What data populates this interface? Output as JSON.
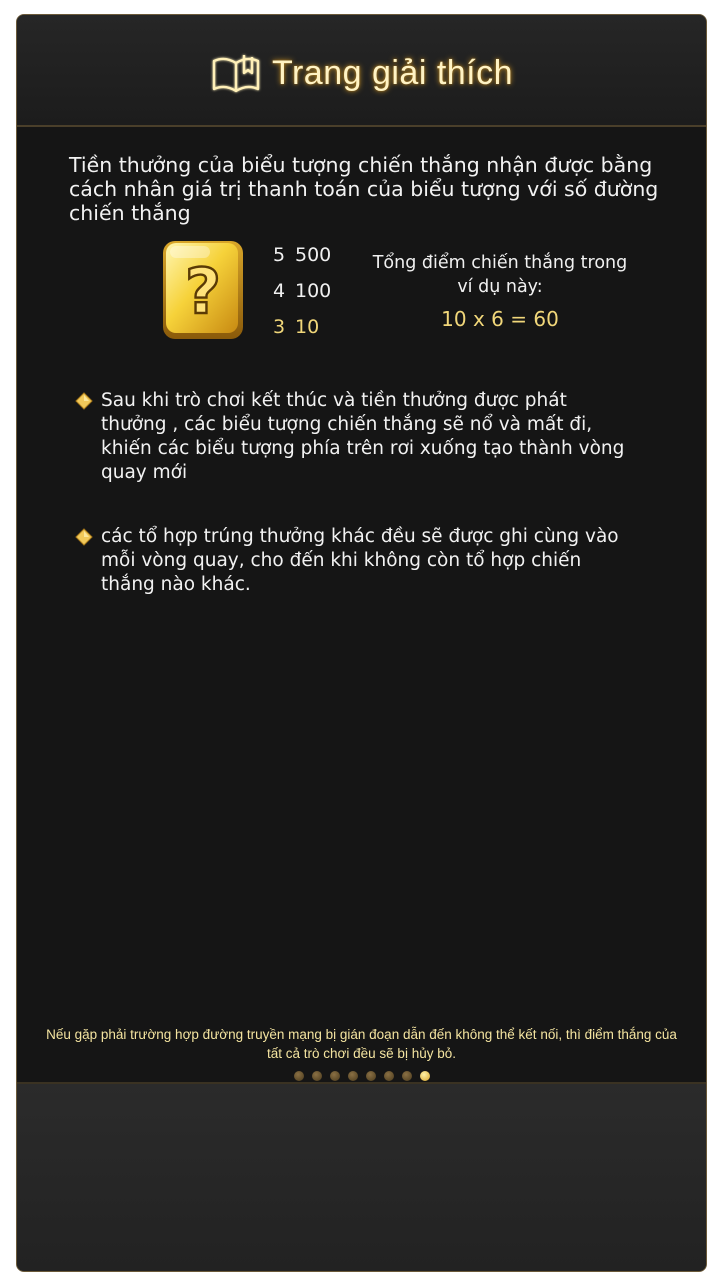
{
  "header": {
    "title": "Trang giải thích",
    "icon": "book-icon"
  },
  "intro": "Tiền thưởng của biểu tượng chiến thắng nhận được bằng cách nhân giá trị thanh toán của biểu tượng với số đường chiến thắng",
  "symbol": {
    "icon": "question-mark-symbol-icon",
    "pay_table": [
      {
        "count": "5",
        "value": "500",
        "highlight": false
      },
      {
        "count": "4",
        "value": "100",
        "highlight": false
      },
      {
        "count": "3",
        "value": "10",
        "highlight": true
      }
    ]
  },
  "example": {
    "label": "Tổng điểm chiến thắng trong ví dụ này:",
    "formula": "10 x 6 = 60"
  },
  "rules": [
    "Sau khi trò chơi kết thúc và  tiền thưởng được phát thưởng , các biểu tượng chiến thắng sẽ nổ và mất đi, khiến các biểu tượng phía trên  rơi xuống tạo thành vòng quay mới",
    "các tổ hợp trúng thưởng khác đều sẽ được ghi cùng vào mỗi vòng quay, cho đến khi không còn tổ hợp chiến thắng nào khác."
  ],
  "footer_note": "Nếu gặp phải trường hợp đường truyền mạng bị gián đoạn dẫn đến không thể kết nối, thì điểm thắng của tất cả trò chơi đều sẽ bị hủy bỏ.",
  "pagination": {
    "total_pages": 8,
    "current_page": 8
  },
  "colors": {
    "accent_gold": "#f1d77a",
    "background": "#151515",
    "title_glow": "#c8962a"
  }
}
